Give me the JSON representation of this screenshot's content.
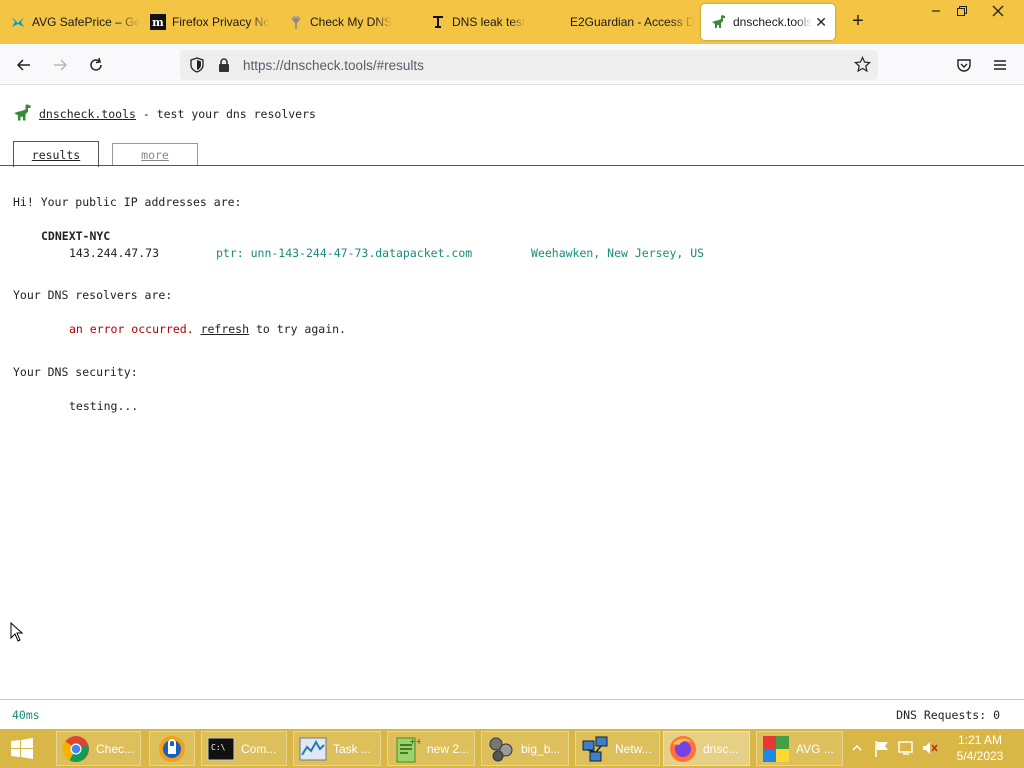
{
  "browser": {
    "tabs": [
      {
        "title": "AVG SafePrice – Ge",
        "icon": "avg-safeprice-icon"
      },
      {
        "title": "Firefox Privacy No",
        "icon": "mozilla-m-icon"
      },
      {
        "title": "Check My DNS",
        "icon": "tree-icon"
      },
      {
        "title": "DNS leak test",
        "icon": "dnsleak-icon"
      },
      {
        "title": "E2Guardian - Access D",
        "icon": "none"
      },
      {
        "title": "dnscheck.tools",
        "icon": "dinosaur-icon",
        "active": true,
        "close": "✕"
      }
    ],
    "new_tab": "+",
    "window_controls": {
      "minimize": "—",
      "restore": "❐",
      "close": "✕"
    },
    "url": "https://dnscheck.tools/#results"
  },
  "page": {
    "site_link": "dnscheck.tools",
    "site_tagline": " - test your dns resolvers",
    "tabs": {
      "results": "results",
      "more": "more"
    },
    "ip_heading": "Hi! Your public IP addresses are:",
    "provider": "CDNEXT-NYC",
    "ip_address": "143.244.47.73",
    "ptr": "ptr: unn-143-244-47-73.datapacket.com",
    "location": "Weehawken, New Jersey, US",
    "resolvers_heading": "Your DNS resolvers are:",
    "error_text": "an error occurred.",
    "refresh_link": "refresh",
    "retry_text": "to try again.",
    "security_heading": "Your DNS security:",
    "security_status": "testing..."
  },
  "footer": {
    "latency": "40ms",
    "dns_requests": "DNS Requests: 0"
  },
  "taskbar": {
    "items": [
      {
        "label": "Chec...",
        "icon": "chrome-icon"
      },
      {
        "label": "",
        "icon": "avg-browser-icon"
      },
      {
        "label": "Com...",
        "icon": "command-prompt-icon"
      },
      {
        "label": "Task ...",
        "icon": "task-manager-icon"
      },
      {
        "label": "new 2...",
        "icon": "notepad-plus-icon"
      },
      {
        "label": "big_b...",
        "icon": "media-player-icon"
      },
      {
        "label": "Netw...",
        "icon": "network-icon"
      },
      {
        "label": "dnsc...",
        "icon": "firefox-icon",
        "active": true
      },
      {
        "label": "AVG ...",
        "icon": "avg-icon"
      }
    ],
    "clock_time": "1:21 AM",
    "clock_date": "5/4/2023"
  },
  "colors": {
    "tabstrip": "#f4c545",
    "taskbar": "#d9b746",
    "ptr_green": "#198c7b",
    "error_red": "#b00000",
    "muted": "#777777"
  }
}
